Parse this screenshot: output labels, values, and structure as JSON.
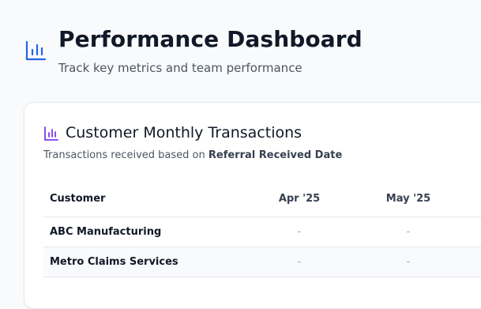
{
  "header": {
    "title": "Performance Dashboard",
    "subtitle": "Track key metrics and team performance",
    "icon": "bar-chart-icon",
    "accent_color": "#2563eb"
  },
  "card": {
    "icon": "bar-chart-icon",
    "icon_color": "#7c3aed",
    "title": "Customer Monthly Transactions",
    "subtitle_prefix": "Transactions received based on ",
    "subtitle_emphasis": "Referral Received Date"
  },
  "table": {
    "columns": [
      "Customer",
      "Apr '25",
      "May '25"
    ],
    "rows": [
      {
        "customer": "ABC Manufacturing",
        "values": [
          "-",
          "-"
        ]
      },
      {
        "customer": "Metro Claims Services",
        "values": [
          "-",
          "-"
        ]
      }
    ]
  }
}
